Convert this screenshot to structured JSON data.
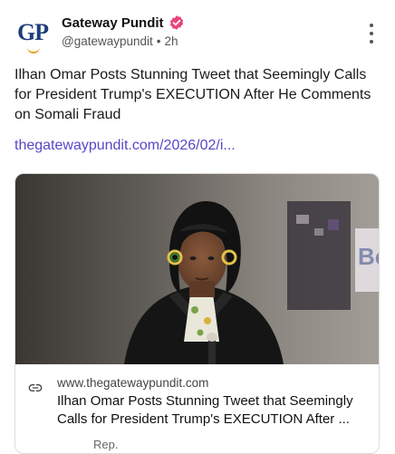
{
  "author": {
    "avatar_text": "GP",
    "name": "Gateway Pundit",
    "handle": "@gatewaypundit",
    "separator": "•",
    "time": "2h",
    "verified_color": "#e8457a"
  },
  "post": {
    "text": "Ilhan Omar Posts Stunning Tweet that Seemingly Calls for President Trump's EXECUTION After He Comments on Somali Fraud",
    "link_text": "thegatewaypundit.com/2026/02/i..."
  },
  "link_card": {
    "domain": "www.thegatewaypundit.com",
    "title": "Ilhan Omar Posts Stunning Tweet that Seemingly Calls for President Trump's EXECUTION After ...",
    "subtext": "Rep."
  },
  "colors": {
    "link": "#5548c8",
    "avatar_brand": "#1f3d7a"
  },
  "icons": [
    "verified-badge-icon",
    "more-options-icon",
    "link-icon"
  ]
}
